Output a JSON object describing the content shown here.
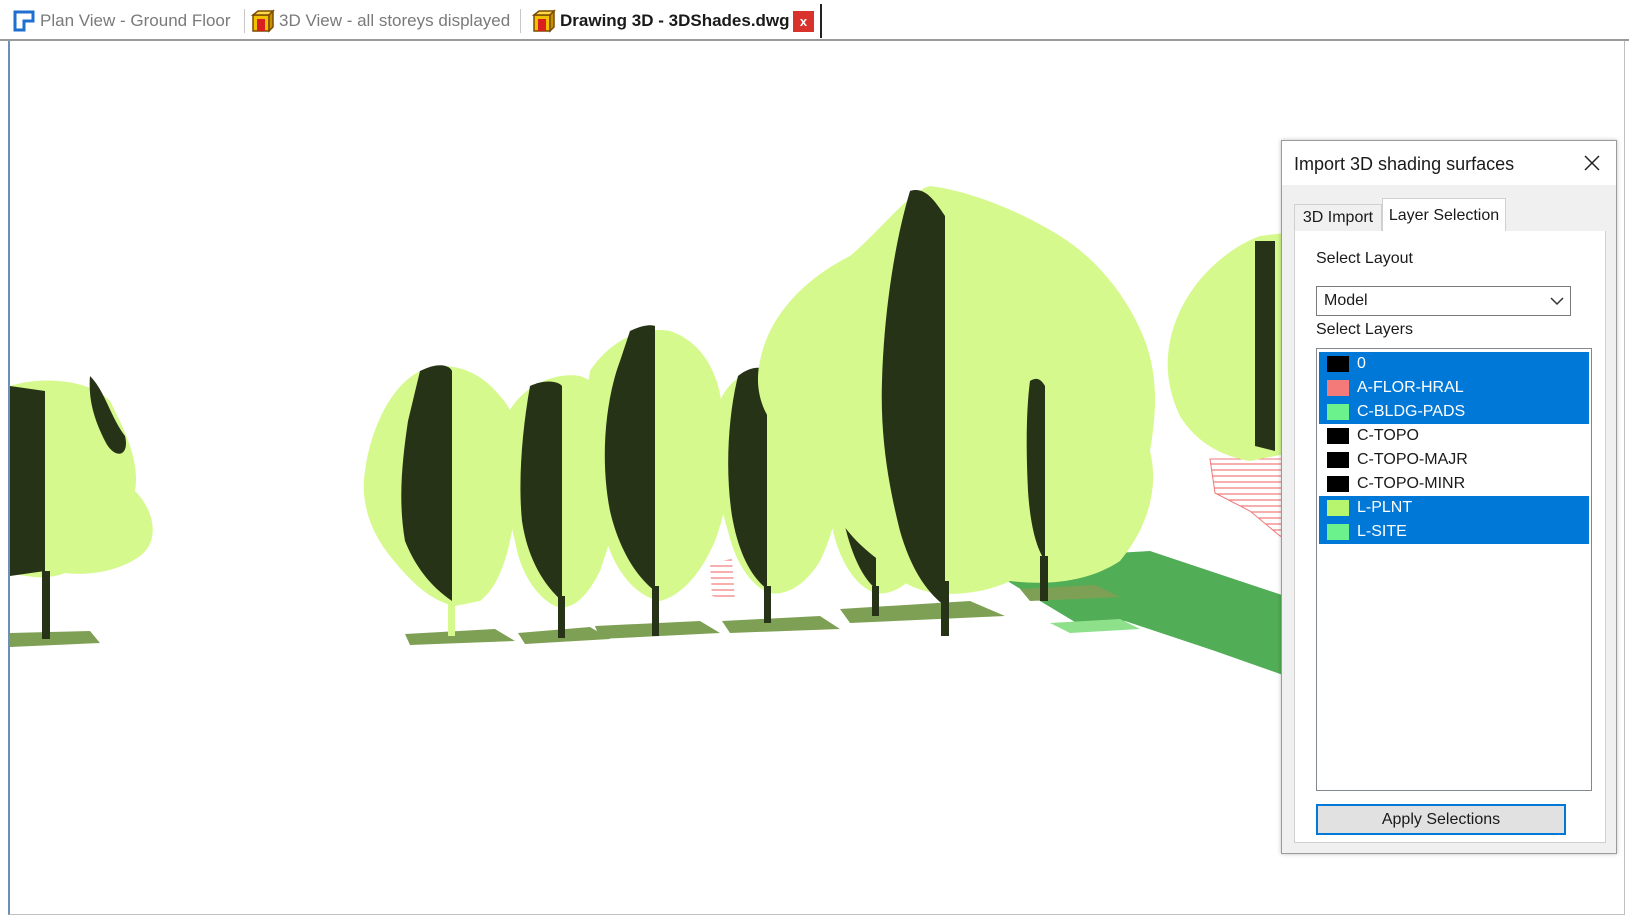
{
  "tabs": [
    {
      "label": "Plan View - Ground Floor",
      "icon": "plan-view-icon",
      "active": false
    },
    {
      "label": "3D View - all storeys displayed",
      "icon": "3d-box-icon",
      "active": false
    },
    {
      "label": "Drawing 3D - 3DShades.dwg",
      "icon": "3d-box-icon",
      "active": true
    }
  ],
  "tab_close": "x",
  "dialog": {
    "title": "Import 3D shading surfaces",
    "tabs": [
      {
        "label": "3D Import",
        "selected": false
      },
      {
        "label": "Layer Selection",
        "selected": true
      }
    ],
    "select_layout_label": "Select Layout",
    "layout_value": "Model",
    "select_layers_label": "Select Layers",
    "layers": [
      {
        "name": "0",
        "color": "#000000",
        "selected": true
      },
      {
        "name": "A-FLOR-HRAL",
        "color": "#f47a7a",
        "selected": true
      },
      {
        "name": "C-BLDG-PADS",
        "color": "#6cf28d",
        "selected": true
      },
      {
        "name": "C-TOPO",
        "color": "#000000",
        "selected": false
      },
      {
        "name": "C-TOPO-MAJR",
        "color": "#000000",
        "selected": false
      },
      {
        "name": "C-TOPO-MINR",
        "color": "#000000",
        "selected": false
      },
      {
        "name": "L-PLNT",
        "color": "#b8f56e",
        "selected": true
      },
      {
        "name": "L-SITE",
        "color": "#6cf28d",
        "selected": true
      }
    ],
    "apply_label": "Apply Selections"
  },
  "colors": {
    "canopy_light": "#d5f98c",
    "canopy_dark": "#263316",
    "ground_shadow": "#7ea055",
    "site_pad": "#52ad57",
    "railing": "#f07878",
    "selection": "#0078d7"
  }
}
